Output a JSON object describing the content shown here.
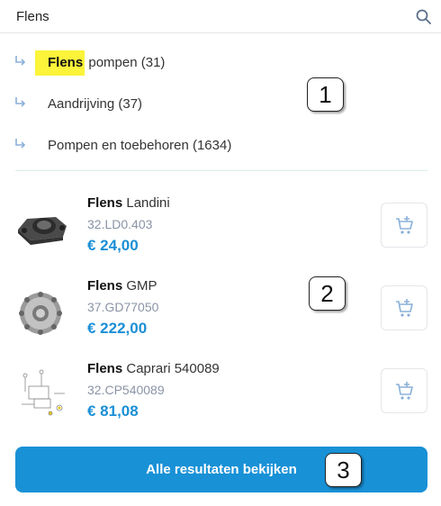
{
  "search": {
    "value": "Flens",
    "placeholder": ""
  },
  "suggestions": [
    {
      "highlight": "Flens",
      "rest": " pompen (31)"
    },
    {
      "highlight": "",
      "rest": "Aandrijving (37)"
    },
    {
      "highlight": "",
      "rest": "Pompen en toebehoren (1634)"
    }
  ],
  "products": [
    {
      "name_highlight": "Flens",
      "name_rest": " Landini",
      "sku": "32.LD0.403",
      "price": "€ 24,00",
      "image_icon": "flange-part-image"
    },
    {
      "name_highlight": "Flens",
      "name_rest": " GMP",
      "sku": "37.GD77050",
      "price": "€ 222,00",
      "image_icon": "pump-flange-image"
    },
    {
      "name_highlight": "Flens",
      "name_rest": " Caprari 540089",
      "sku": "32.CP540089",
      "price": "€ 81,08",
      "image_icon": "exploded-diagram-image"
    }
  ],
  "badges": [
    "1",
    "2",
    "3"
  ],
  "all_results_label": "Alle resultaten bekijken",
  "colors": {
    "accent": "#1991d6",
    "price": "#1a8fd6",
    "highlight": "#fbf43a"
  }
}
